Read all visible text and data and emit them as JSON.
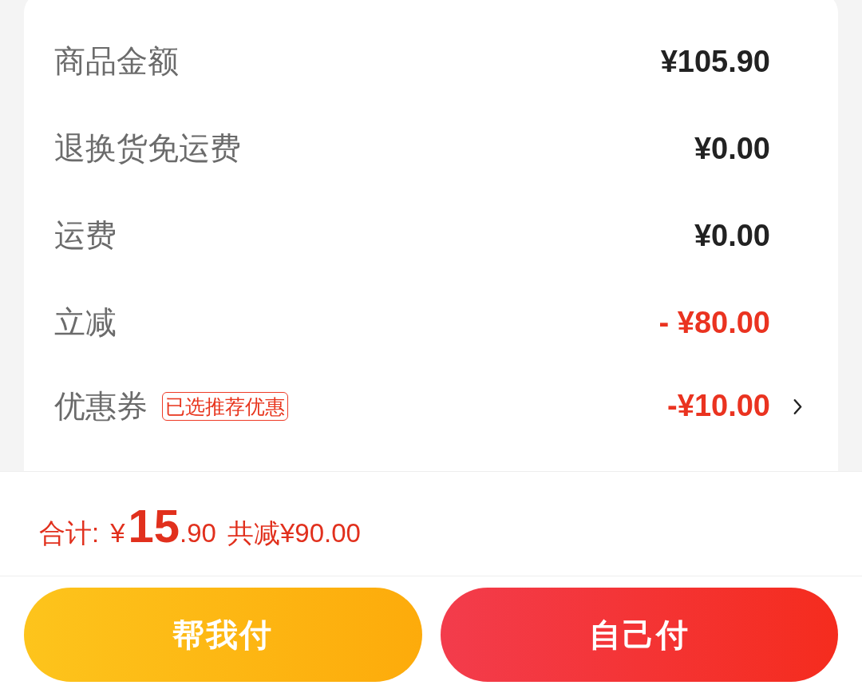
{
  "summary": {
    "rows": [
      {
        "kind": "amount",
        "label": "商品金额",
        "value": "¥105.90"
      },
      {
        "kind": "amount",
        "label": "退换货免运费",
        "value": "¥0.00"
      },
      {
        "kind": "amount",
        "label": "运费",
        "value": "¥0.00"
      },
      {
        "kind": "discount",
        "label": "立减",
        "value": "- ¥80.00"
      },
      {
        "kind": "coupon",
        "label": "优惠券",
        "tag": "已选推荐优惠",
        "value": "-¥10.00"
      }
    ]
  },
  "footer": {
    "total": {
      "label": "合计:",
      "currency": "¥",
      "integer": "15",
      "fraction": ".90",
      "savings": "共减¥90.00"
    },
    "buttons": [
      {
        "kind": "secondary",
        "label": "帮我付"
      },
      {
        "kind": "primary",
        "label": "自己付"
      }
    ]
  }
}
